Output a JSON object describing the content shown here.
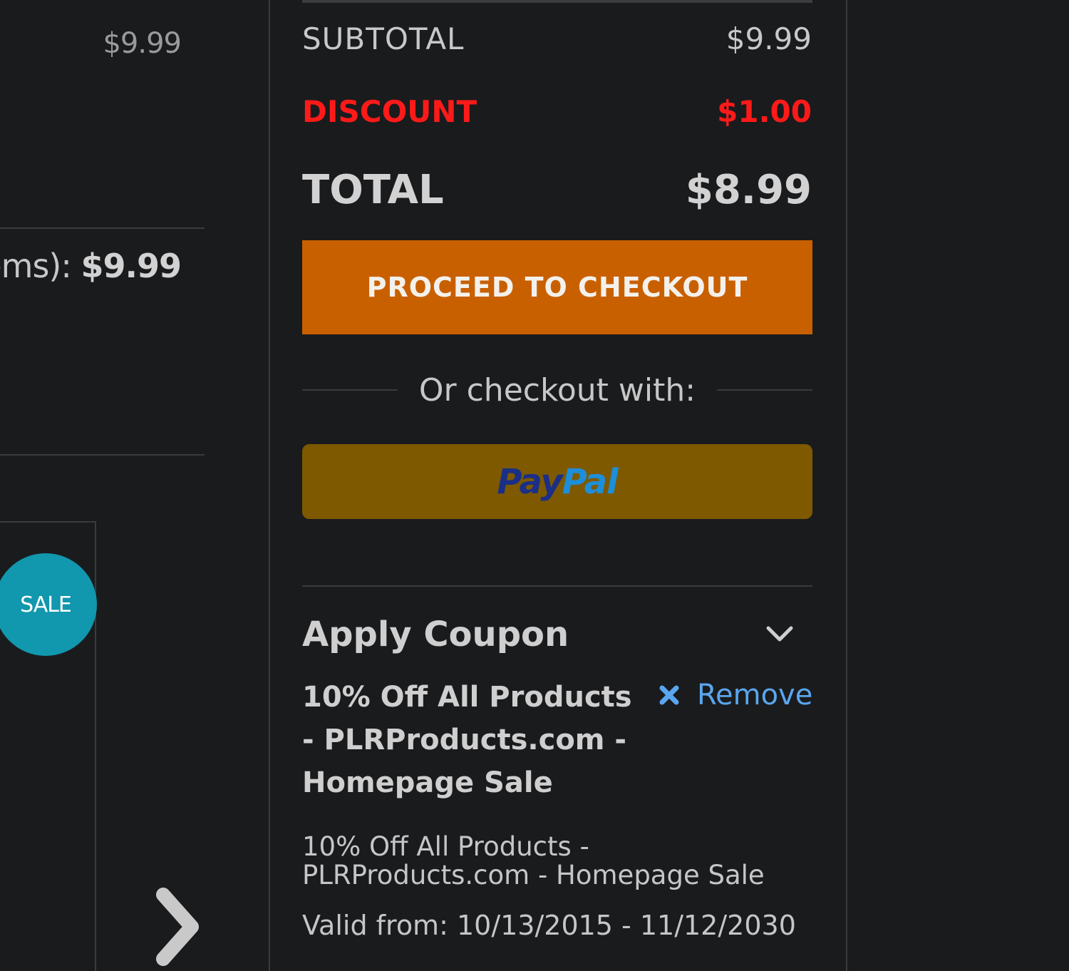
{
  "cart": {
    "item_price": "$9.99",
    "subtotal_label_fragment": "ems):",
    "subtotal_amount": "$9.99"
  },
  "related": {
    "sale_badge": "SALE",
    "next_icon": "chevron-right-icon"
  },
  "summary": {
    "subtotal_label": "SUBTOTAL",
    "subtotal_value": "$9.99",
    "discount_label": "DISCOUNT",
    "discount_value": "$1.00",
    "total_label": "TOTAL",
    "total_value": "$8.99",
    "checkout_button": "PROCEED TO CHECKOUT",
    "or_checkout_with": "Or checkout with:",
    "paypal_label_part1": "Pay",
    "paypal_label_part2": "Pal"
  },
  "coupon": {
    "title": "Apply Coupon",
    "toggle_icon": "chevron-down-icon",
    "applied_name": "10% Off All Products - PLRProducts.com - Homepage Sale",
    "remove_label": "Remove",
    "remove_icon": "close-icon",
    "description": "10% Off All Products - PLRProducts.com - Homepage Sale",
    "valid": "Valid from: 10/13/2015 - 11/12/2030"
  },
  "colors": {
    "background": "#1a1b1d",
    "checkout_button": "#c96000",
    "paypal_button": "#7e5900",
    "discount": "#ff1a1a",
    "sale_badge": "#1197ae",
    "link": "#5aa6ee"
  }
}
